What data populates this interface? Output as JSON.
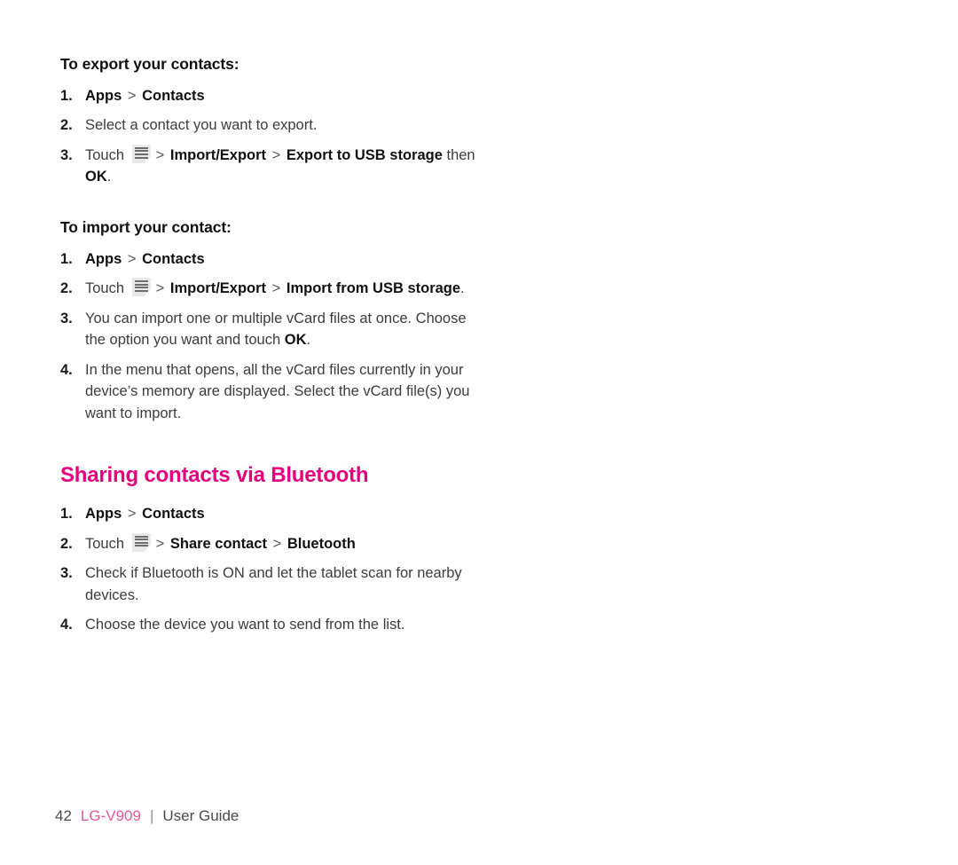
{
  "document": {
    "page_number": "42",
    "model": "LG-V909",
    "divider": "|",
    "guide_label": "User Guide"
  },
  "colors": {
    "accent_pink": "#E6007E",
    "footer_pink": "#E8559A",
    "body_text": "#3C3C3C",
    "bold_text": "#111111",
    "icon_background": "#E9E9E9",
    "icon_bars": "#6D6D6D"
  },
  "icons": {
    "menu": "menu-icon"
  },
  "sections": [
    {
      "heading": "To export your contacts:",
      "steps": [
        {
          "number": "1.",
          "parts": [
            {
              "type": "bold",
              "text": "Apps"
            },
            {
              "type": "sep",
              "text": ">"
            },
            {
              "type": "bold",
              "text": "Contacts"
            }
          ]
        },
        {
          "number": "2.",
          "parts": [
            {
              "type": "text",
              "text": "Select a contact you want to export."
            }
          ]
        },
        {
          "number": "3.",
          "parts": [
            {
              "type": "text",
              "text": "Touch"
            },
            {
              "type": "icon",
              "text": "menu-icon"
            },
            {
              "type": "sep",
              "text": ">"
            },
            {
              "type": "bold",
              "text": "Import/Export"
            },
            {
              "type": "sep",
              "text": ">"
            },
            {
              "type": "bold",
              "text": "Export to USB storage"
            },
            {
              "type": "text",
              "text": "then"
            },
            {
              "type": "bold",
              "text": "OK"
            },
            {
              "type": "text",
              "text": "."
            }
          ]
        }
      ]
    },
    {
      "heading": "To import your contact:",
      "steps": [
        {
          "number": "1.",
          "parts": [
            {
              "type": "bold",
              "text": "Apps"
            },
            {
              "type": "sep",
              "text": ">"
            },
            {
              "type": "bold",
              "text": "Contacts"
            }
          ]
        },
        {
          "number": "2.",
          "parts": [
            {
              "type": "text",
              "text": "Touch"
            },
            {
              "type": "icon",
              "text": "menu-icon"
            },
            {
              "type": "sep",
              "text": ">"
            },
            {
              "type": "bold",
              "text": "Import/Export"
            },
            {
              "type": "sep",
              "text": ">"
            },
            {
              "type": "bold",
              "text": "Import from USB storage"
            },
            {
              "type": "text",
              "text": "."
            }
          ]
        },
        {
          "number": "3.",
          "parts": [
            {
              "type": "text",
              "text": "You can import one or multiple vCard files at once. Choose the option you want and touch"
            },
            {
              "type": "bold",
              "text": "OK"
            },
            {
              "type": "text",
              "text": "."
            }
          ]
        },
        {
          "number": "4.",
          "parts": [
            {
              "type": "text",
              "text": "In the menu that opens, all the vCard files currently in your device’s memory are displayed. Select the vCard file(s) you want to import."
            }
          ]
        }
      ]
    },
    {
      "heading": "Sharing contacts via Bluetooth",
      "heading_style": "chapter",
      "steps": [
        {
          "number": "1.",
          "parts": [
            {
              "type": "bold",
              "text": "Apps"
            },
            {
              "type": "sep",
              "text": ">"
            },
            {
              "type": "bold",
              "text": "Contacts"
            }
          ]
        },
        {
          "number": "2.",
          "parts": [
            {
              "type": "text",
              "text": "Touch"
            },
            {
              "type": "icon",
              "text": "menu-icon"
            },
            {
              "type": "sep",
              "text": ">"
            },
            {
              "type": "bold",
              "text": "Share contact"
            },
            {
              "type": "sep",
              "text": ">"
            },
            {
              "type": "bold",
              "text": "Bluetooth"
            }
          ]
        },
        {
          "number": "3.",
          "parts": [
            {
              "type": "text",
              "text": "Check if Bluetooth is ON and let the tablet scan for nearby devices."
            }
          ]
        },
        {
          "number": "4.",
          "parts": [
            {
              "type": "text",
              "text": "Choose the device you want to send from the list."
            }
          ]
        }
      ]
    }
  ]
}
